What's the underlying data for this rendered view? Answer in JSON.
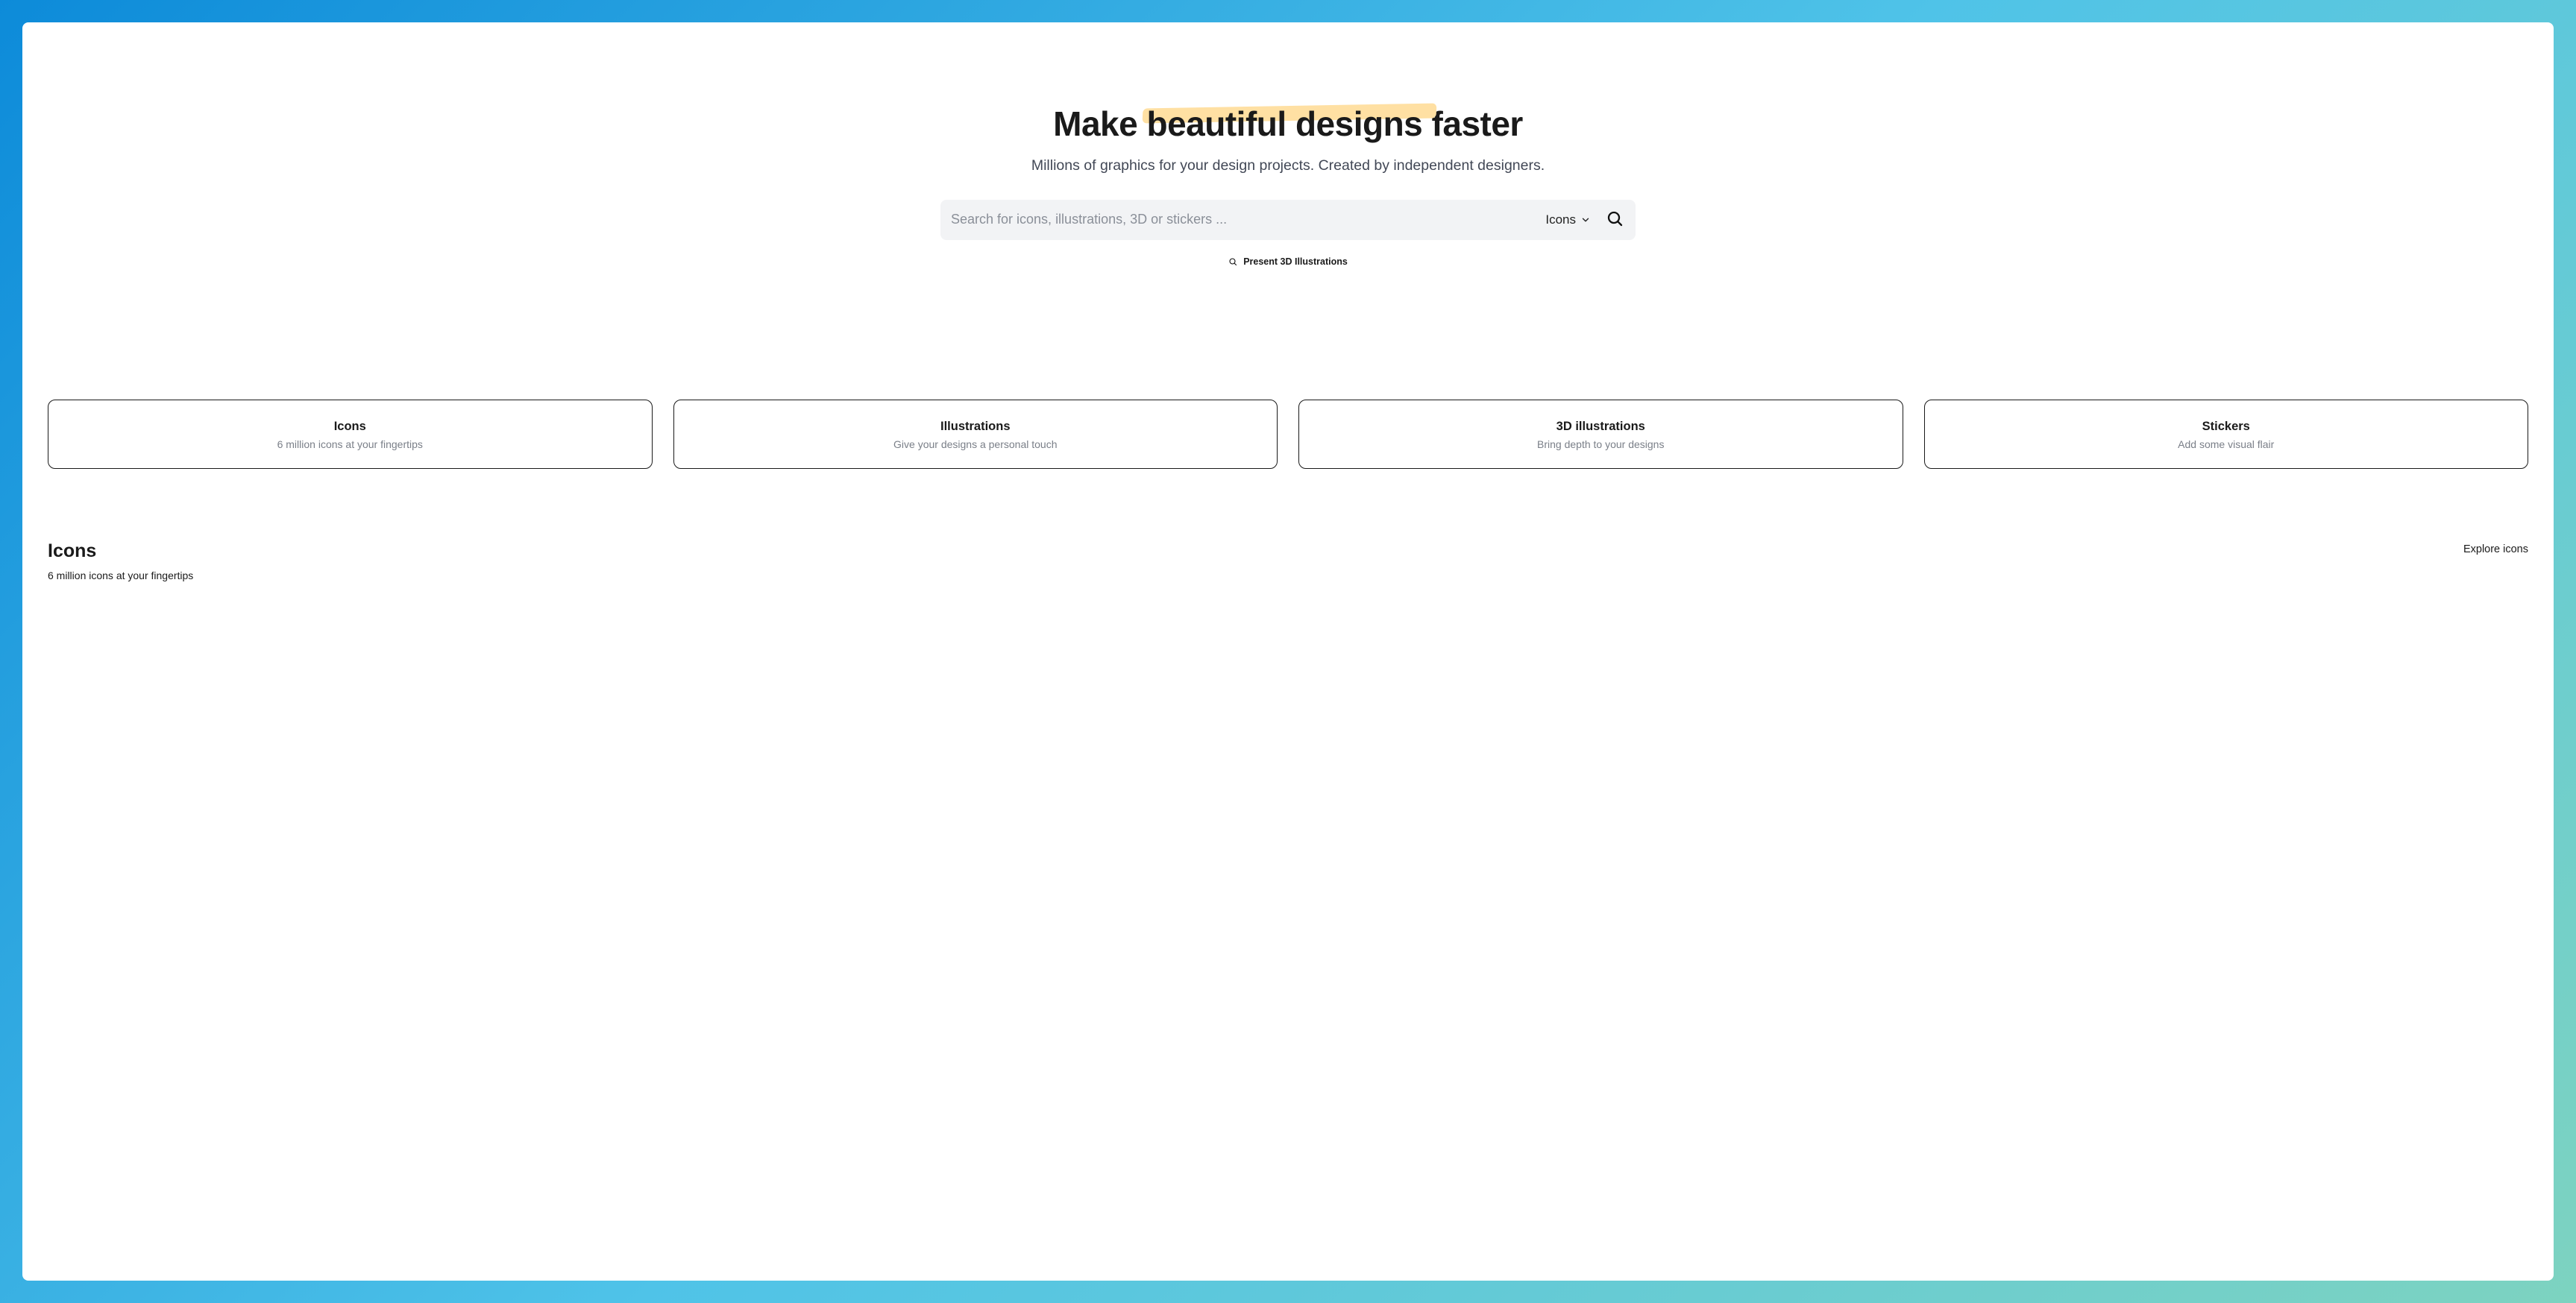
{
  "hero": {
    "title_pre": "Make ",
    "title_highlight": "beautiful designs",
    "title_post": " faster",
    "subtitle": "Millions of graphics for your design projects. Created by independent designers."
  },
  "search": {
    "placeholder": "Search for icons, illustrations, 3D or stickers ...",
    "filter_label": "Icons"
  },
  "suggestion": {
    "label": "Present 3D Illustrations"
  },
  "cards": [
    {
      "title": "Icons",
      "subtitle": "6 million icons at your fingertips"
    },
    {
      "title": "Illustrations",
      "subtitle": "Give your designs a personal touch"
    },
    {
      "title": "3D illustrations",
      "subtitle": "Bring depth to your designs"
    },
    {
      "title": "Stickers",
      "subtitle": "Add some visual flair"
    }
  ],
  "section": {
    "title": "Icons",
    "subtitle": "6 million icons at your fingertips",
    "link": "Explore icons"
  }
}
